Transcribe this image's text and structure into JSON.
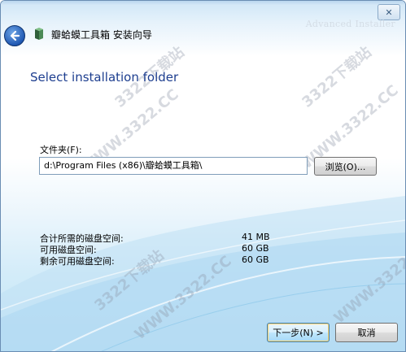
{
  "window": {
    "title": "瓣蛤蟆工具箱 安装向导",
    "brand": "Advanced Installer",
    "close_label": "✕"
  },
  "page": {
    "heading": "Select installation folder",
    "folder_label": "文件夹(F):",
    "folder_path": "d:\\Program Files (x86)\\瓣蛤蟆工具箱\\",
    "browse_label": "浏览(O)..."
  },
  "disk": {
    "rows": [
      {
        "label": "合计所需的磁盘空间:",
        "value": "41 MB"
      },
      {
        "label": "可用磁盘空间:",
        "value": "60 GB"
      },
      {
        "label": "剩余可用磁盘空间:",
        "value": "60 GB"
      }
    ]
  },
  "footer": {
    "next_label": "下一步(N) >",
    "cancel_label": "取消"
  },
  "watermarks": {
    "site_cn": "3322下载站",
    "site_url": "WWW.3322.CC"
  },
  "colors": {
    "heading": "#1d3e8f",
    "accent_blue": "#1f58b3"
  }
}
